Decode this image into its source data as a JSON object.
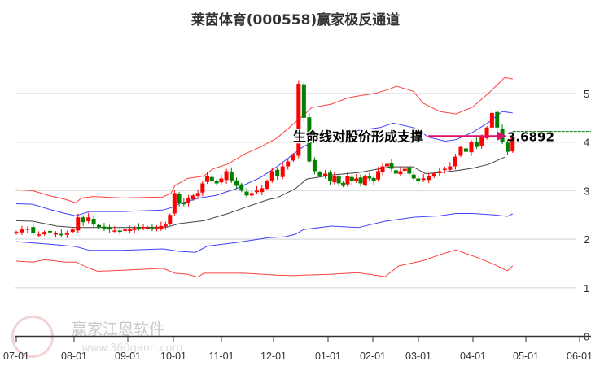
{
  "title": "莱茵体育(000558)赢家极反通道",
  "watermark": {
    "brand": "赢家江恩软件",
    "url": "www.360gann.com",
    "seal": "江赢恩家"
  },
  "chart_data": {
    "type": "candlestick",
    "title": "莱茵体育(000558)赢家极反通道",
    "x_ticks": [
      "07-01",
      "08-01",
      "09-01",
      "10-01",
      "11-01",
      "12-01",
      "01-01",
      "02-01",
      "03-01",
      "04-01",
      "05-01",
      "06-01"
    ],
    "x_unit": "months since 07-01",
    "y_ticks": [
      "0",
      "1",
      "2",
      "3",
      "4",
      "5"
    ],
    "ylim": [
      0,
      5.5
    ],
    "grid": true,
    "candles_start": 0,
    "candles_end": 9.75,
    "closes": [
      2.15,
      2.2,
      2.22,
      2.12,
      2.1,
      2.15,
      2.14,
      2.12,
      2.08,
      2.12,
      2.2,
      2.45,
      2.35,
      2.45,
      2.3,
      2.25,
      2.22,
      2.2,
      2.18,
      2.15,
      2.2,
      2.2,
      2.23,
      2.22,
      2.25,
      2.24,
      2.22,
      2.24,
      2.27,
      2.3,
      2.5,
      2.95,
      2.75,
      2.72,
      2.85,
      2.9,
      2.95,
      3.15,
      3.3,
      3.2,
      3.15,
      3.25,
      3.4,
      3.2,
      3.1,
      3.0,
      2.9,
      2.95,
      3.0,
      3.05,
      3.2,
      3.4,
      3.3,
      3.5,
      3.6,
      3.75,
      5.2,
      4.5,
      3.6,
      3.4,
      3.3,
      3.35,
      3.2,
      3.3,
      3.15,
      3.1,
      3.3,
      3.2,
      3.25,
      3.15,
      3.3,
      3.25,
      3.2,
      3.4,
      3.5,
      3.55,
      3.45,
      3.35,
      3.4,
      3.45,
      3.35,
      3.25,
      3.2,
      3.25,
      3.3,
      3.35,
      3.4,
      3.45,
      3.5,
      3.7,
      3.9,
      3.8,
      4.0,
      3.9,
      4.1,
      4.3,
      4.6,
      4.3,
      4.0,
      3.8,
      4.1
    ],
    "series": [
      {
        "name": "upper-outer",
        "color": "#ff2020",
        "points": [
          [
            0,
            3.02
          ],
          [
            0.28,
            3.0
          ],
          [
            0.56,
            2.9
          ],
          [
            0.85,
            2.82
          ],
          [
            1.03,
            2.75
          ],
          [
            1.14,
            2.85
          ],
          [
            1.36,
            2.88
          ],
          [
            1.89,
            2.85
          ],
          [
            2.77,
            2.87
          ],
          [
            2.95,
            2.95
          ],
          [
            3.03,
            3.1
          ],
          [
            3.29,
            3.25
          ],
          [
            3.63,
            3.3
          ],
          [
            3.83,
            3.45
          ],
          [
            4.13,
            3.55
          ],
          [
            4.44,
            3.75
          ],
          [
            4.75,
            3.9
          ],
          [
            5.06,
            4.08
          ],
          [
            5.55,
            4.55
          ],
          [
            5.7,
            4.71
          ],
          [
            6.07,
            4.78
          ],
          [
            6.44,
            4.91
          ],
          [
            6.67,
            4.95
          ],
          [
            7.04,
            5.0
          ],
          [
            7.34,
            5.08
          ],
          [
            7.52,
            5.15
          ],
          [
            7.88,
            5.05
          ],
          [
            8.09,
            4.8
          ],
          [
            8.39,
            4.63
          ],
          [
            8.69,
            4.58
          ],
          [
            8.99,
            4.72
          ],
          [
            9.29,
            5.0
          ],
          [
            9.6,
            5.33
          ],
          [
            9.75,
            5.3
          ]
        ]
      },
      {
        "name": "upper-inner",
        "color": "#2020ff",
        "points": [
          [
            0,
            2.73
          ],
          [
            0.28,
            2.72
          ],
          [
            0.56,
            2.62
          ],
          [
            0.85,
            2.53
          ],
          [
            1.03,
            2.48
          ],
          [
            1.29,
            2.57
          ],
          [
            1.89,
            2.57
          ],
          [
            2.77,
            2.6
          ],
          [
            2.95,
            2.65
          ],
          [
            3.12,
            2.73
          ],
          [
            3.54,
            2.85
          ],
          [
            3.88,
            2.9
          ],
          [
            4.28,
            3.04
          ],
          [
            4.75,
            3.27
          ],
          [
            5.06,
            3.49
          ],
          [
            5.55,
            3.91
          ],
          [
            6.07,
            4.16
          ],
          [
            6.67,
            4.24
          ],
          [
            7.16,
            4.3
          ],
          [
            7.45,
            4.39
          ],
          [
            7.88,
            4.3
          ],
          [
            8.19,
            4.1
          ],
          [
            8.49,
            4.02
          ],
          [
            8.69,
            4.05
          ],
          [
            8.99,
            4.2
          ],
          [
            9.29,
            4.4
          ],
          [
            9.55,
            4.63
          ],
          [
            9.75,
            4.6
          ]
        ]
      },
      {
        "name": "lifeline",
        "color": "#222222",
        "points": [
          [
            0,
            2.38
          ],
          [
            0.28,
            2.37
          ],
          [
            0.7,
            2.27
          ],
          [
            1.03,
            2.24
          ],
          [
            1.89,
            2.24
          ],
          [
            2.86,
            2.25
          ],
          [
            3.12,
            2.32
          ],
          [
            3.63,
            2.38
          ],
          [
            4.13,
            2.53
          ],
          [
            4.44,
            2.65
          ],
          [
            4.91,
            2.82
          ],
          [
            5.06,
            2.85
          ],
          [
            5.4,
            3.04
          ],
          [
            5.61,
            3.24
          ],
          [
            6.07,
            3.32
          ],
          [
            6.67,
            3.37
          ],
          [
            7.39,
            3.49
          ],
          [
            7.88,
            3.49
          ],
          [
            8.13,
            3.35
          ],
          [
            8.39,
            3.37
          ],
          [
            8.69,
            3.41
          ],
          [
            8.99,
            3.46
          ],
          [
            9.29,
            3.54
          ],
          [
            9.6,
            3.69
          ]
        ]
      },
      {
        "name": "lower-inner",
        "color": "#2020ff",
        "points": [
          [
            0,
            1.95
          ],
          [
            0.56,
            1.9
          ],
          [
            1.03,
            1.85
          ],
          [
            1.29,
            1.77
          ],
          [
            1.89,
            1.77
          ],
          [
            2.77,
            1.8
          ],
          [
            3.12,
            1.75
          ],
          [
            3.46,
            1.73
          ],
          [
            3.71,
            1.86
          ],
          [
            4.28,
            1.93
          ],
          [
            4.91,
            2.03
          ],
          [
            5.21,
            2.05
          ],
          [
            5.4,
            2.1
          ],
          [
            5.55,
            2.2
          ],
          [
            6.07,
            2.27
          ],
          [
            6.67,
            2.24
          ],
          [
            7.27,
            2.37
          ],
          [
            7.88,
            2.45
          ],
          [
            8.39,
            2.48
          ],
          [
            8.69,
            2.53
          ],
          [
            8.99,
            2.53
          ],
          [
            9.4,
            2.5
          ],
          [
            9.65,
            2.47
          ],
          [
            9.75,
            2.52
          ]
        ]
      },
      {
        "name": "lower-outer",
        "color": "#ff2020",
        "points": [
          [
            0,
            1.55
          ],
          [
            0.28,
            1.53
          ],
          [
            0.49,
            1.58
          ],
          [
            0.85,
            1.53
          ],
          [
            1.03,
            1.53
          ],
          [
            1.29,
            1.4
          ],
          [
            1.44,
            1.34
          ],
          [
            1.89,
            1.36
          ],
          [
            2.77,
            1.4
          ],
          [
            3.03,
            1.3
          ],
          [
            3.29,
            1.28
          ],
          [
            3.51,
            1.22
          ],
          [
            3.63,
            1.3
          ],
          [
            3.88,
            1.3
          ],
          [
            4.44,
            1.3
          ],
          [
            5.06,
            1.26
          ],
          [
            5.36,
            1.25
          ],
          [
            5.55,
            1.26
          ],
          [
            6.07,
            1.28
          ],
          [
            6.67,
            1.31
          ],
          [
            7.27,
            1.23
          ],
          [
            7.57,
            1.45
          ],
          [
            8.09,
            1.56
          ],
          [
            8.39,
            1.68
          ],
          [
            8.69,
            1.78
          ],
          [
            8.88,
            1.7
          ],
          [
            9.09,
            1.62
          ],
          [
            9.4,
            1.48
          ],
          [
            9.65,
            1.35
          ],
          [
            9.75,
            1.45
          ]
        ]
      }
    ],
    "reference_line": {
      "value": 4.22,
      "color": "#008000",
      "from": 9.75
    },
    "annotation": {
      "text": "生命线对股价形成支撑",
      "value_label": "3.6892",
      "value": 3.6892,
      "arrow_color": "#e0106a"
    },
    "up_color": "#ff0000",
    "down_color": "#008000"
  }
}
